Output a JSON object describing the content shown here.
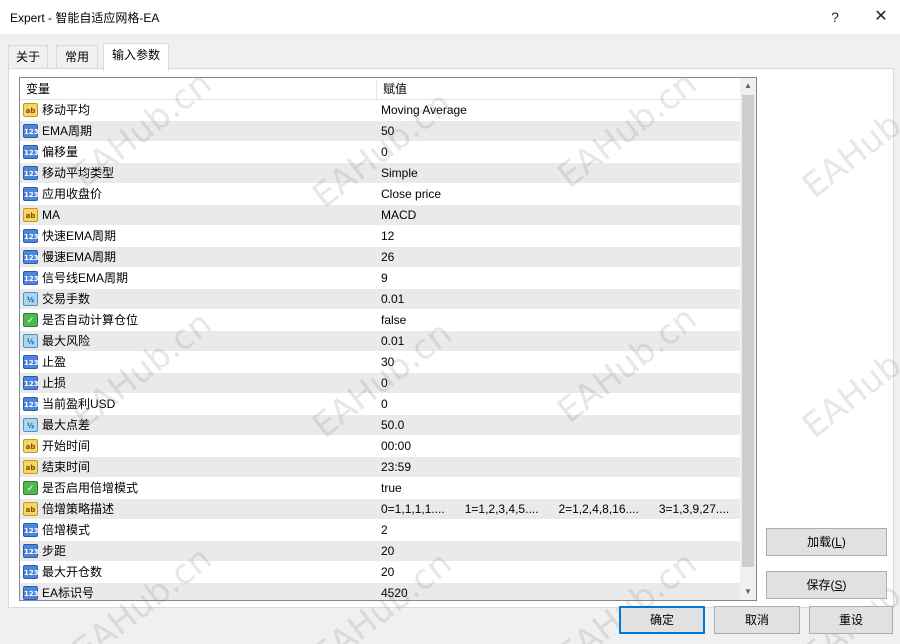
{
  "window": {
    "title": "Expert - 智能自适应网格-EA",
    "help_label": "?",
    "close_label": "✕"
  },
  "tabs": [
    {
      "label": "关于"
    },
    {
      "label": "常用"
    },
    {
      "label": "输入参数",
      "active": true
    }
  ],
  "table": {
    "headers": {
      "variable": "变量",
      "value": "赋值"
    },
    "rows": [
      {
        "type": "ab",
        "name": "移动平均",
        "value": "Moving Average"
      },
      {
        "type": "num",
        "name": "EMA周期",
        "value": "50"
      },
      {
        "type": "num",
        "name": "偏移量",
        "value": "0"
      },
      {
        "type": "num",
        "name": "移动平均类型",
        "value": "Simple"
      },
      {
        "type": "num",
        "name": "应用收盘价",
        "value": "Close price"
      },
      {
        "type": "ab",
        "name": "MA",
        "value": "MACD"
      },
      {
        "type": "num",
        "name": "快速EMA周期",
        "value": "12"
      },
      {
        "type": "num",
        "name": "慢速EMA周期",
        "value": "26"
      },
      {
        "type": "num",
        "name": "信号线EMA周期",
        "value": "9"
      },
      {
        "type": "dbl",
        "name": "交易手数",
        "value": "0.01"
      },
      {
        "type": "bool",
        "name": "是否自动计算仓位",
        "value": "false"
      },
      {
        "type": "dbl",
        "name": "最大风险",
        "value": "0.01"
      },
      {
        "type": "num",
        "name": "止盈",
        "value": "30"
      },
      {
        "type": "num",
        "name": "止损",
        "value": "0"
      },
      {
        "type": "num",
        "name": "当前盈利USD",
        "value": "0"
      },
      {
        "type": "dbl",
        "name": "最大点差",
        "value": "50.0"
      },
      {
        "type": "ab",
        "name": "开始时间",
        "value": "00:00"
      },
      {
        "type": "ab",
        "name": "结束时间",
        "value": "23:59"
      },
      {
        "type": "bool",
        "name": "是否启用倍增模式",
        "value": "true"
      },
      {
        "type": "ab",
        "name": "倍增策略描述",
        "value": "0=1,1,1,1....      1=1,2,3,4,5....      2=1,2,4,8,16....      3=1,3,9,27...."
      },
      {
        "type": "num",
        "name": "倍增模式",
        "value": "2"
      },
      {
        "type": "num",
        "name": "步距",
        "value": "20"
      },
      {
        "type": "num",
        "name": "最大开仓数",
        "value": "20"
      },
      {
        "type": "num",
        "name": "EA标识号",
        "value": "4520"
      }
    ]
  },
  "icons": {
    "ab": "ab",
    "num": "123",
    "dbl": "½",
    "bool": "✓"
  },
  "buttons": {
    "load": "加载(L)",
    "save": "保存(S)",
    "ok": "确定",
    "cancel": "取消",
    "reset": "重设"
  },
  "watermark": "EAHub.cn"
}
